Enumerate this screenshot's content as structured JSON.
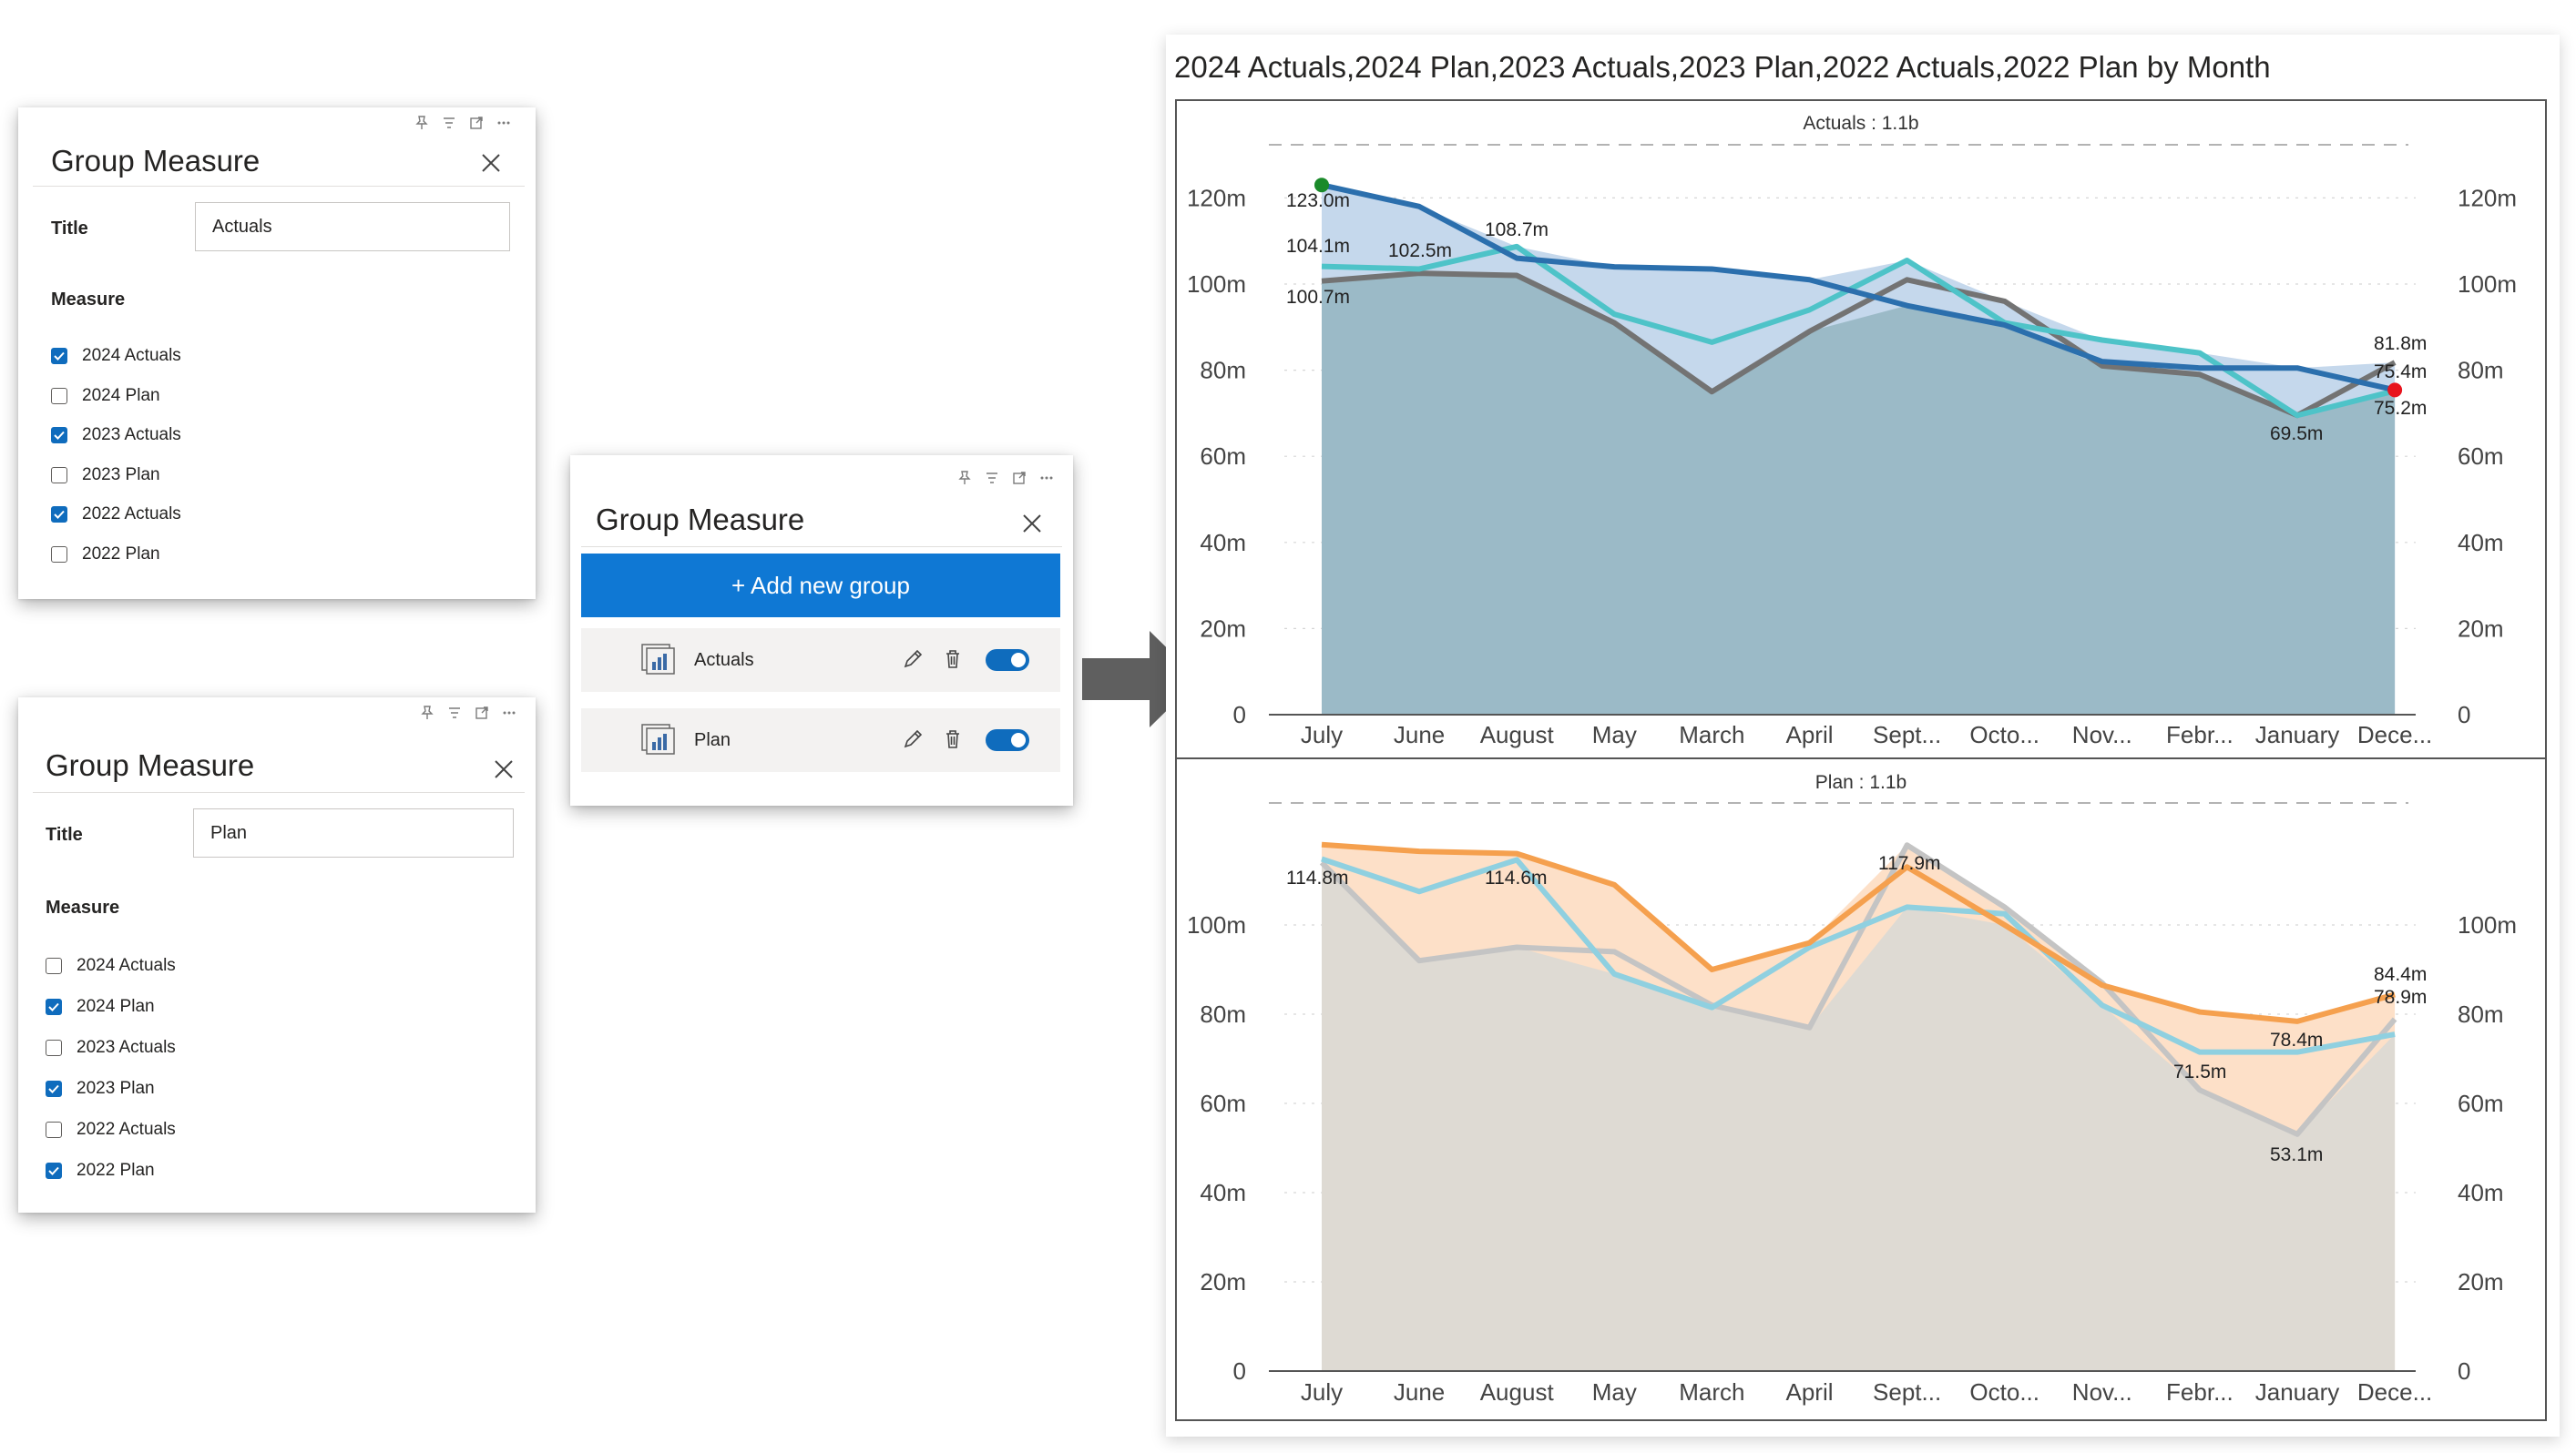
{
  "panel_actuals": {
    "title": "Group Measure",
    "title_label": "Title",
    "title_value": "Actuals",
    "measure_label": "Measure",
    "measures": [
      {
        "label": "2024 Actuals",
        "checked": true
      },
      {
        "label": "2024 Plan",
        "checked": false
      },
      {
        "label": "2023 Actuals",
        "checked": true
      },
      {
        "label": "2023 Plan",
        "checked": false
      },
      {
        "label": "2022 Actuals",
        "checked": true
      },
      {
        "label": "2022 Plan",
        "checked": false
      }
    ]
  },
  "panel_plan": {
    "title": "Group Measure",
    "title_label": "Title",
    "title_value": "Plan",
    "measure_label": "Measure",
    "measures": [
      {
        "label": "2024 Actuals",
        "checked": false
      },
      {
        "label": "2024 Plan",
        "checked": true
      },
      {
        "label": "2023 Actuals",
        "checked": false
      },
      {
        "label": "2023 Plan",
        "checked": true
      },
      {
        "label": "2022 Actuals",
        "checked": false
      },
      {
        "label": "2022 Plan",
        "checked": true
      }
    ]
  },
  "panel_groups": {
    "title": "Group Measure",
    "add_button": "+ Add new group",
    "groups": [
      {
        "name": "Actuals",
        "enabled": true
      },
      {
        "name": "Plan",
        "enabled": true
      }
    ]
  },
  "visual": {
    "title": "2024 Actuals,2024 Plan,2023 Actuals,2023 Plan,2022 Actuals,2022 Plan by Month"
  },
  "colors": {
    "accent": "#0f78d4",
    "toggle": "#0f6cbd",
    "actuals_2024": "#2b6fad",
    "actuals_2023": "#4ec3c8",
    "actuals_2022": "#737373",
    "actuals_fill": "#9bbac7",
    "actuals_diff_fill": "#c5d8ec",
    "plan_2024": "#f5a04e",
    "plan_2023": "#8fd0e0",
    "plan_2022": "#c4c4c4",
    "plan_fill": "#dedad3",
    "plan_diff_fill": "#fde0c8",
    "max_marker": "#1a8a2a",
    "min_marker": "#e8141d"
  },
  "chart_data": [
    {
      "type": "area",
      "header": "Actuals : 1.1b",
      "categories": [
        "July",
        "June",
        "August",
        "May",
        "March",
        "April",
        "Sept...",
        "Octo...",
        "Nov...",
        "Febr...",
        "January",
        "Dece..."
      ],
      "y_ticks": [
        "0",
        "20m",
        "40m",
        "60m",
        "80m",
        "100m",
        "120m"
      ],
      "ylim": [
        0,
        130
      ],
      "series": [
        {
          "name": "2024 Actuals",
          "values": [
            123.0,
            118.0,
            106.0,
            104.0,
            103.5,
            101.0,
            95.0,
            90.5,
            82.0,
            80.5,
            80.5,
            75.4
          ]
        },
        {
          "name": "2023 Actuals",
          "values": [
            104.1,
            103.5,
            108.7,
            93.0,
            86.5,
            94.0,
            105.5,
            91.0,
            87.0,
            84.0,
            69.5,
            75.2
          ]
        },
        {
          "name": "2022 Actuals",
          "values": [
            100.7,
            102.5,
            102.0,
            91.0,
            75.0,
            89.0,
            101.0,
            96.0,
            81.0,
            79.0,
            69.5,
            81.8
          ]
        }
      ],
      "data_labels": [
        "123.0m",
        "104.1m",
        "100.7m",
        "102.5m",
        "108.7m",
        "69.5m",
        "81.8m",
        "75.4m",
        "75.2m"
      ]
    },
    {
      "type": "area",
      "header": "Plan : 1.1b",
      "categories": [
        "July",
        "June",
        "August",
        "May",
        "March",
        "April",
        "Sept...",
        "Octo...",
        "Nov...",
        "Febr...",
        "January",
        "Dece..."
      ],
      "y_ticks": [
        "0",
        "20m",
        "40m",
        "60m",
        "80m",
        "100m"
      ],
      "ylim": [
        0,
        130
      ],
      "series": [
        {
          "name": "2024 Plan",
          "values": [
            118.0,
            116.5,
            116.0,
            109.0,
            90.0,
            96.0,
            113.0,
            100.0,
            86.5,
            80.5,
            78.4,
            84.4
          ]
        },
        {
          "name": "2023 Plan",
          "values": [
            114.8,
            107.5,
            114.6,
            89.0,
            81.5,
            95.0,
            104.0,
            102.5,
            82.0,
            71.5,
            71.5,
            75.5
          ]
        },
        {
          "name": "2022 Plan",
          "values": [
            114.0,
            92.0,
            95.0,
            94.0,
            82.0,
            77.0,
            117.9,
            104.0,
            87.0,
            63.0,
            53.1,
            78.9
          ]
        }
      ],
      "data_labels": [
        "114.8m",
        "114.6m",
        "117.9m",
        "71.5m",
        "53.1m",
        "78.4m",
        "84.4m",
        "78.9m"
      ]
    }
  ]
}
